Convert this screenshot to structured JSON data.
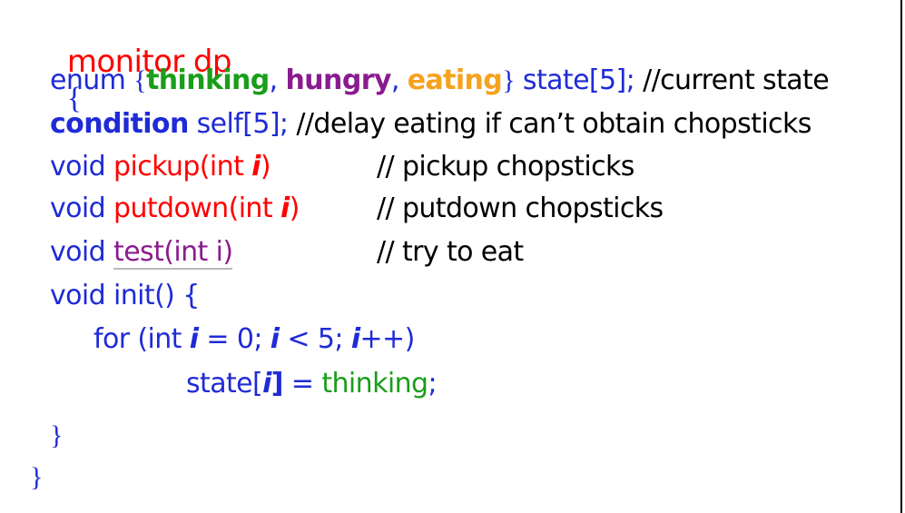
{
  "code": {
    "line0": {
      "keyword": "monitor dp",
      "brace": "{"
    },
    "line1": {
      "enum": "enum",
      "open": "{",
      "thinking": "thinking",
      "comma1": ", ",
      "hungry": "hungry",
      "comma2": ", ",
      "eating": "eating",
      "close": "}",
      "state": " state[5];",
      "comment": " //current state"
    },
    "line2": {
      "condition": "condition",
      "self": " self[5];",
      "comment": " //delay eating if can’t obtain chopsticks"
    },
    "line3": {
      "void": "void ",
      "name": "pickup(int ",
      "i": "i",
      "close": ")",
      "comment": "// pickup chopsticks"
    },
    "line4": {
      "void": "void ",
      "name": "putdown(int ",
      "i": "i",
      "close": ")",
      "comment": "// putdown chopsticks"
    },
    "line5": {
      "void": "void ",
      "name": "test(int i)",
      "comment": "// try to eat"
    },
    "line6": {
      "text": "void init() {"
    },
    "line7": {
      "for": "for (int ",
      "i1": "i",
      "eq": " = 0; ",
      "i2": "i",
      "lt": " < 5; ",
      "i3": "i",
      "inc": "++)"
    },
    "line8": {
      "state": "state[",
      "i": "i",
      "close": "]",
      "eq": " = ",
      "thinking": "thinking",
      "semi": ";"
    },
    "line9": {
      "brace": "}"
    },
    "line10": {
      "brace": "}"
    }
  },
  "colors": {
    "keyword_red": "#ff0000",
    "code_blue": "#1f2bd6",
    "thinking_green": "#1a9e1a",
    "hungry_purple": "#8a1b8f",
    "eating_orange": "#f6a21e",
    "comment_black": "#000000"
  }
}
